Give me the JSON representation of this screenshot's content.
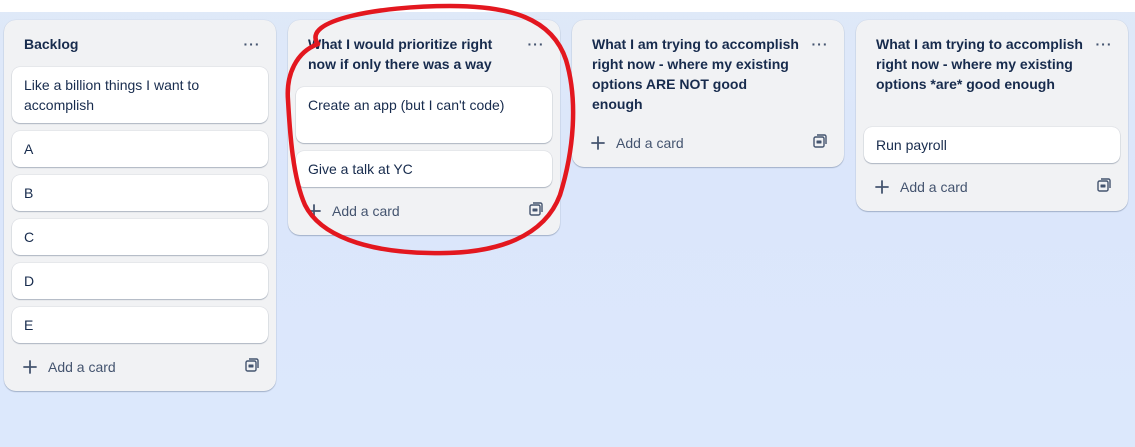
{
  "board": {
    "lists": [
      {
        "title": "Backlog",
        "menu_label": "···",
        "cards": [
          "Like a billion things I want to accomplish",
          "A",
          "B",
          "C",
          "D",
          "E"
        ],
        "add_card_label": "Add a card"
      },
      {
        "title": "What I would prioritize right now if only there was a way",
        "menu_label": "···",
        "cards": [
          "Create an app (but I can't code)",
          "Give a talk at YC"
        ],
        "add_card_label": "Add a card"
      },
      {
        "title": "What I am trying to accomplish right now - where my existing options ARE NOT good enough",
        "menu_label": "···",
        "cards": [],
        "add_card_label": "Add a card"
      },
      {
        "title": "What I am trying to accomplish right now - where my existing options *are* good enough",
        "menu_label": "···",
        "cards": [
          "Run payroll"
        ],
        "add_card_label": "Add a card"
      }
    ]
  },
  "icons": {
    "menu": "ellipsis-icon",
    "add": "plus-icon",
    "template": "card-template-icon"
  },
  "colors": {
    "background": "#dce8fc",
    "list_background": "#f1f2f4",
    "card_background": "#ffffff",
    "text": "#172b4d",
    "subtle_text": "#44546f",
    "annotation": "#e3171f"
  }
}
